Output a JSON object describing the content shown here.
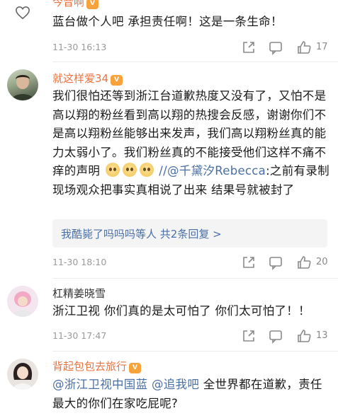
{
  "comments": [
    {
      "username": "今昔啊",
      "has_badge": true,
      "text": "蓝台做个人吧 承担责任啊！这是一条生命！",
      "time": "11-30 16:13",
      "likes": "17"
    },
    {
      "username": "就这样爱34",
      "has_badge": true,
      "text_part1": "我们很怕还等到浙江台道歉热度又没有了，又怕不是高以翔的粉丝看到高以翔的热搜会反感，谢谢你们不是高以翔粉丝能够出来发声，我们高以翔粉丝真的能力太弱小了。我们粉丝真的不能接受他们这样不痛不痒的声明",
      "text_sep": "//",
      "mention": "@千黛汐Rebecca",
      "text_part2": ":之前有录制现场观众把事实真相说了出来 结果号就被封了",
      "reply_summary": "我酷毙了吗吗吗等人  共2条回复 >",
      "time": "11-30 18:10",
      "likes": "20"
    },
    {
      "username": "杠精姜晓雪",
      "has_badge": false,
      "text": "浙江卫视 你们真的是太可怕了 你们太可怕了！！",
      "time": "11-30 17:47",
      "likes": "13"
    },
    {
      "username": "背起包包去旅行",
      "has_badge": true,
      "mention1": "@浙江卫视中国蓝",
      "mention2": "@追我吧",
      "text": " 全世界都在道歉，责任最大的你们在家吃屁呢?"
    }
  ],
  "badge_text": "V",
  "colors": {
    "username_vip": "#eb7340",
    "mention": "#4a6fa5",
    "meta": "#9a9a9a"
  }
}
